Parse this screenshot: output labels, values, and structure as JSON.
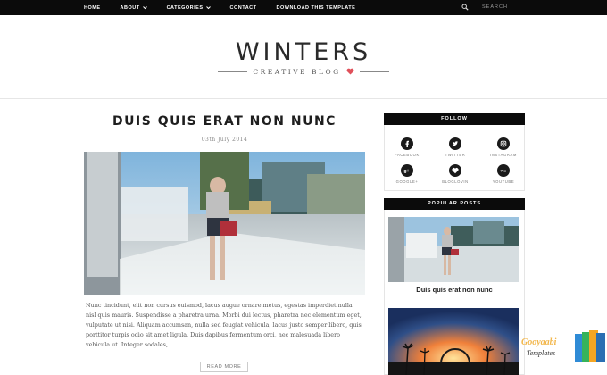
{
  "nav": {
    "items": [
      {
        "label": "Home",
        "has_dropdown": false
      },
      {
        "label": "About",
        "has_dropdown": true
      },
      {
        "label": "Categories",
        "has_dropdown": true
      },
      {
        "label": "Contact",
        "has_dropdown": false
      },
      {
        "label": "Download This Template",
        "has_dropdown": false
      }
    ],
    "search_placeholder": "SEARCH"
  },
  "header": {
    "logo": "WINTERS",
    "tagline": "CREATIVE BLOG",
    "heart_color": "#e0505a"
  },
  "post": {
    "title": "Duis quis erat non nunc",
    "date": "03th July 2014",
    "body": "Nunc tincidunt, elit non cursus euismod, lacus augue ornare metus, egestas imperdiet nulla nisl quis mauris. Suspendisse a pharetra urna. Morbi dui lectus, pharetra nec elementum eget, vulputate ut nisi. Aliquam accumsan, nulla sed feugiat vehicula, lacus justo semper libero, quis porttitor turpis odio sit amet ligula. Duis dapibus fermentum orci, nec malesuada libero vehicula ut. Integer sodales,",
    "read_more": "Read More"
  },
  "sidebar": {
    "follow_title": "Follow",
    "social": [
      {
        "label": "Facebook",
        "icon": "facebook-icon"
      },
      {
        "label": "Twitter",
        "icon": "twitter-icon"
      },
      {
        "label": "Instagram",
        "icon": "instagram-icon"
      },
      {
        "label": "Google+",
        "icon": "googleplus-icon"
      },
      {
        "label": "Bloglovin",
        "icon": "bloglovin-icon"
      },
      {
        "label": "Youtube",
        "icon": "youtube-icon"
      }
    ],
    "popular_title": "Popular Posts",
    "popular_posts": [
      {
        "title": "Duis quis erat non nunc"
      }
    ]
  },
  "badge": {
    "brand": "Gooyaabi",
    "sub": "Templates"
  },
  "colors": {
    "bar": "#0b0b0b",
    "accent": "#e0505a"
  }
}
